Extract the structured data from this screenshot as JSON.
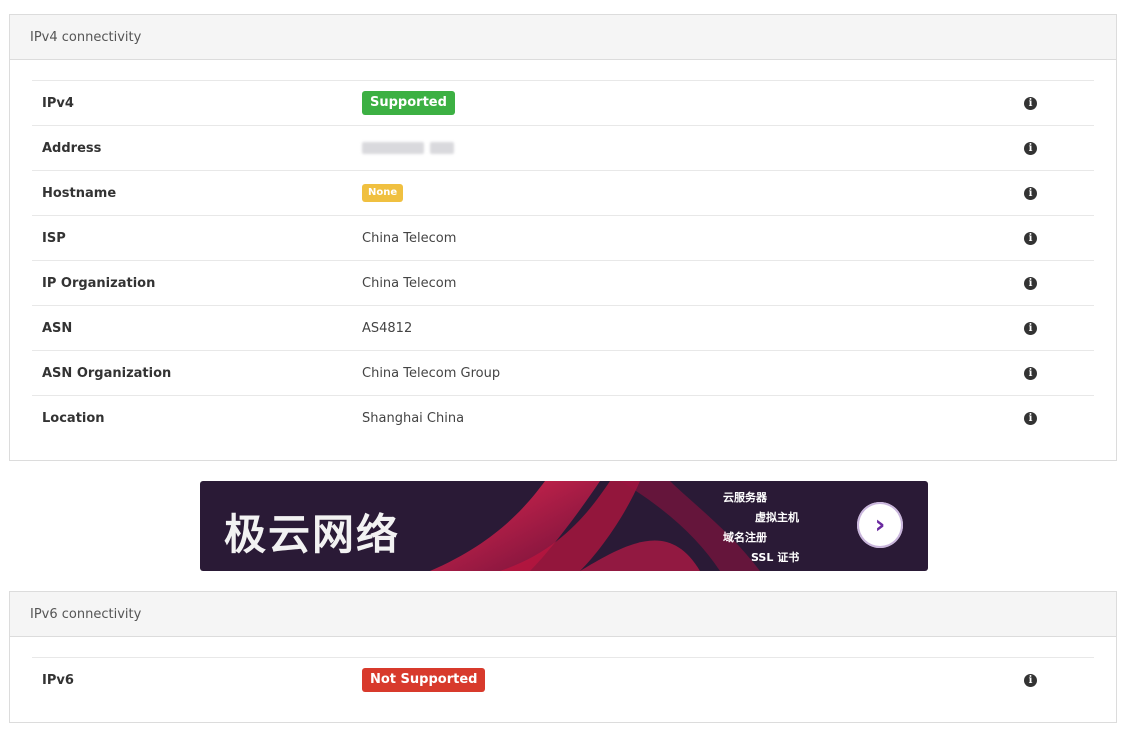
{
  "ipv4": {
    "title": "IPv4 connectivity",
    "rows": [
      {
        "label": "IPv4",
        "value": "Supported",
        "kind": "badge",
        "color": "#3cb043"
      },
      {
        "label": "Address",
        "value": "",
        "kind": "redacted"
      },
      {
        "label": "Hostname",
        "value": "None",
        "kind": "badge-small",
        "color": "#f0c040"
      },
      {
        "label": "ISP",
        "value": "China Telecom",
        "kind": "text"
      },
      {
        "label": "IP Organization",
        "value": "China Telecom",
        "kind": "text"
      },
      {
        "label": "ASN",
        "value": "AS4812",
        "kind": "text"
      },
      {
        "label": "ASN Organization",
        "value": "China Telecom Group",
        "kind": "text"
      },
      {
        "label": "Location",
        "value": "Shanghai China",
        "kind": "text"
      }
    ]
  },
  "banner": {
    "title": "极云网络",
    "links": [
      "云服务器",
      "虚拟主机",
      "域名注册",
      "SSL 证书"
    ],
    "accent": "#e8194a"
  },
  "ipv6": {
    "title": "IPv6 connectivity",
    "rows": [
      {
        "label": "IPv6",
        "value": "Not Supported",
        "kind": "badge",
        "color": "#d83a2c"
      }
    ]
  },
  "icons": {
    "info": "info-circle-icon",
    "arrow": "chevron-right-icon"
  }
}
